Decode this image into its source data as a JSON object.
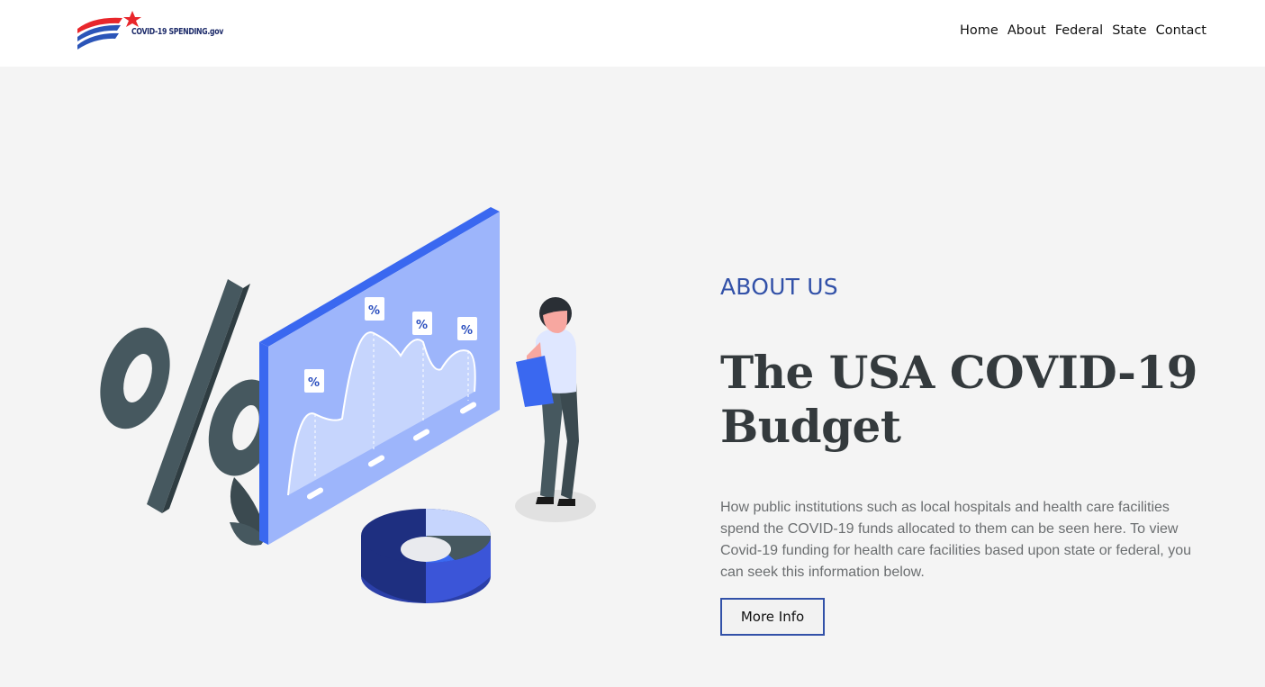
{
  "header": {
    "logo_text": "COVID-19 SPENDING.gov",
    "nav": [
      "Home",
      "About",
      "Federal",
      "State",
      "Contact"
    ]
  },
  "hero": {
    "section_label": "ABOUT US",
    "title": "The USA COVID-19 Budget",
    "description": "How public institutions such as local hospitals and health care facilities spend the COVID-19 funds allocated to them can be seen here. To view Covid-19 funding for health care facilities based upon state or federal, you can seek this information below.",
    "button_label": "More Info",
    "illustration_symbol": "%"
  },
  "colors": {
    "accent": "#3251a8",
    "brand_red": "#e8262b",
    "brand_blue": "#2b55b8",
    "heading": "#343a3d",
    "body_text": "#6b6e70",
    "background": "#f4f4f4"
  },
  "icons": [
    "logo-flag-icon",
    "star-icon",
    "percent-icon",
    "chart-board-icon",
    "donut-chart-icon",
    "woman-figure-icon",
    "leaf-icon"
  ]
}
